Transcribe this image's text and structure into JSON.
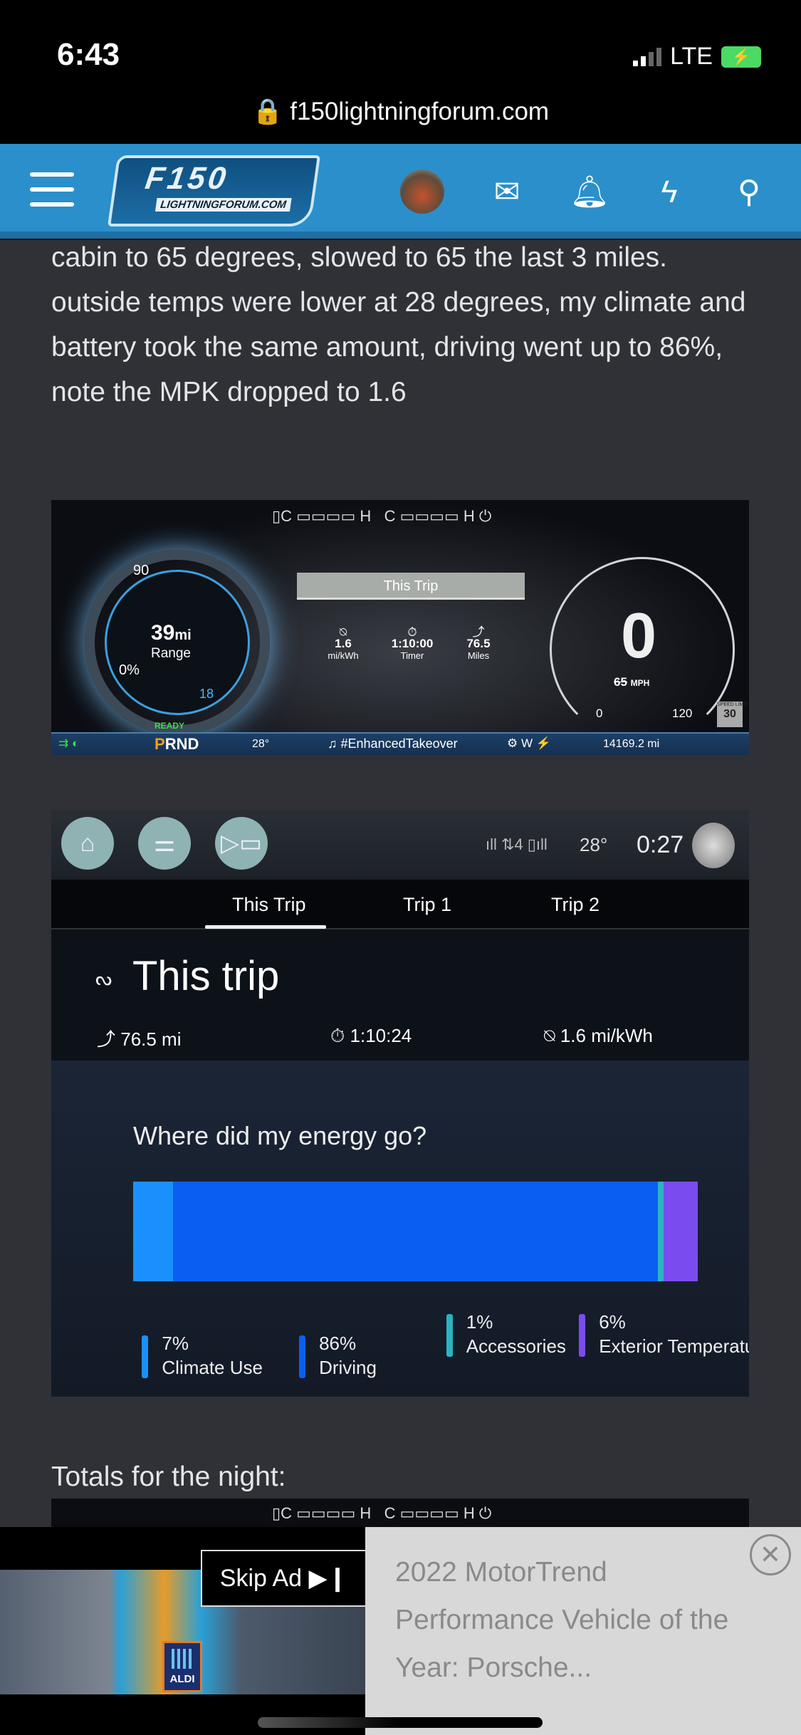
{
  "status_bar": {
    "time": "6:43",
    "network": "LTE",
    "url": "f150lightningforum.com"
  },
  "header": {
    "logo_text": "F150",
    "logo_sub": "LIGHTNINGFORUM.COM",
    "icons": [
      "menu-icon",
      "avatar",
      "mail-icon",
      "bell-icon",
      "lightning-icon",
      "search-icon"
    ]
  },
  "post": {
    "paragraph": "cabin to 65 degrees, slowed to 65 the last 3 miles. outside temps were lower at 28 degrees, my climate and battery took the same amount, driving went up to 86%, note the MPK dropped to 1.6",
    "totals_label": "Totals for the night:"
  },
  "cluster": {
    "temp_c": "C",
    "temp_h": "H",
    "range_value": "39",
    "range_unit": "mi",
    "range_label": "Range",
    "charge_top": "90",
    "charge_pct": "0%",
    "regen": "18",
    "trip_title": "This Trip",
    "efficiency": "1.6",
    "efficiency_unit": "mi/kWh",
    "timer": "1:10:00",
    "timer_label": "Timer",
    "miles": "76.5",
    "miles_label": "Miles",
    "speed": "0",
    "set_speed": "65",
    "speed_unit": "MPH",
    "speed_min": "0",
    "speed_max": "120",
    "speed_limit_label": "SPEED LIMIT",
    "speed_limit": "30",
    "ready": "READY",
    "gear_active": "P",
    "gear_rest": "RND",
    "outside_temp": "28°",
    "media": "#EnhancedTakeover",
    "compass": "W",
    "odometer": "14169.2 mi"
  },
  "trip_screen": {
    "temp": "28°",
    "clock": "0:27",
    "tabs": [
      {
        "label": "This Trip",
        "active": true
      },
      {
        "label": "Trip 1"
      },
      {
        "label": "Trip 2"
      }
    ],
    "title": "This trip",
    "distance": "76.5 mi",
    "duration": "1:10:24",
    "efficiency": "1.6 mi/kWh",
    "energy_title": "Where did my energy go?",
    "breakdown": [
      {
        "pct": "7%",
        "label": "Climate Use",
        "value": 7,
        "color": "#1a90ff"
      },
      {
        "pct": "86%",
        "label": "Driving",
        "value": 86,
        "color": "#0b5ef2"
      },
      {
        "pct": "1%",
        "label": "Accessories",
        "value": 1,
        "color": "#2bb3c0"
      },
      {
        "pct": "6%",
        "label": "Exterior Temperature",
        "value": 6,
        "color": "#7a4cf0"
      }
    ]
  },
  "ad": {
    "skip_label": "Skip Ad",
    "brand": "ALDI",
    "title": "2022 MotorTrend Performance Vehicle of the Year: Porsche..."
  }
}
